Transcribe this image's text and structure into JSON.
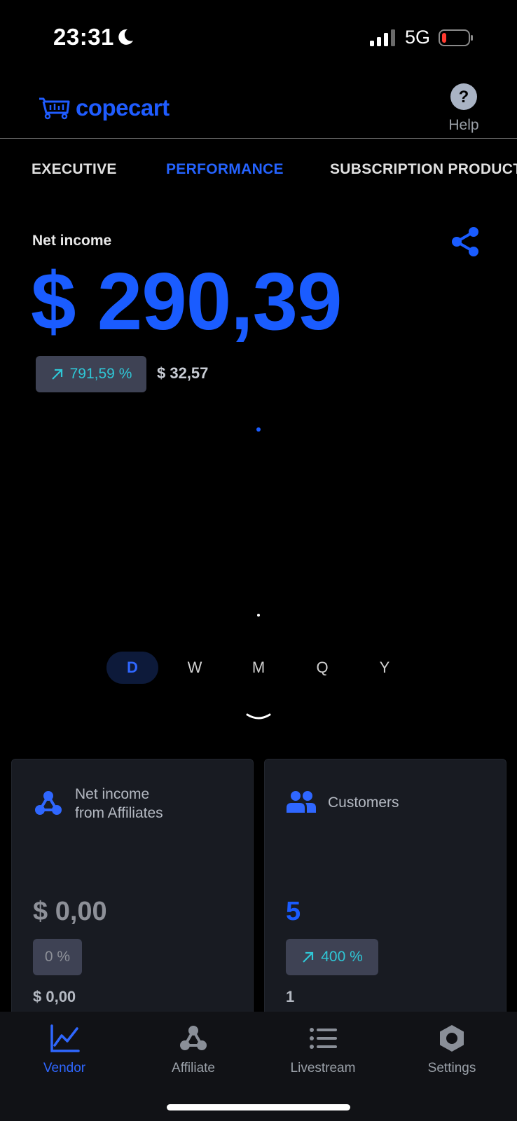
{
  "status_bar": {
    "time": "23:31",
    "network": "5G"
  },
  "header": {
    "logo_text": "copecart",
    "help_label": "Help"
  },
  "tabs": [
    {
      "label": "EXECUTIVE"
    },
    {
      "label": "PERFORMANCE"
    },
    {
      "label": "SUBSCRIPTION PRODUCT"
    }
  ],
  "active_tab": "PERFORMANCE",
  "net_income": {
    "label": "Net income",
    "value": "$ 290,39",
    "delta": "791,59 %",
    "previous": "$ 32,57"
  },
  "periods": [
    "D",
    "W",
    "M",
    "Q",
    "Y"
  ],
  "active_period": "D",
  "cards": [
    {
      "title_line1": "Net income",
      "title_line2": "from Affiliates",
      "value": "$ 0,00",
      "badge": "0 %",
      "sub": "$ 0,00"
    },
    {
      "title_line1": "Customers",
      "title_line2": "",
      "value": "5",
      "badge": "400 %",
      "sub": "1"
    }
  ],
  "bottom_nav": [
    {
      "label": "Vendor"
    },
    {
      "label": "Affiliate"
    },
    {
      "label": "Livestream"
    },
    {
      "label": "Settings"
    }
  ],
  "colors": {
    "accent": "#1a5cff",
    "positive": "#2fc7d6",
    "card_bg": "#181b22"
  }
}
